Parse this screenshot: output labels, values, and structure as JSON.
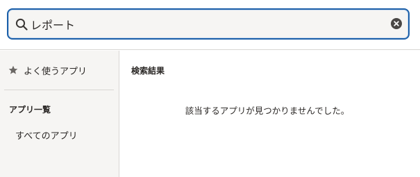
{
  "search": {
    "value": "レポート",
    "icon": "search-icon",
    "clear_icon": "close-circle-icon"
  },
  "sidebar": {
    "favorites": {
      "label": "よく使うアプリ",
      "icon": "star-icon"
    },
    "section_title": "アプリ一覧",
    "all_apps_label": "すべてのアプリ"
  },
  "main": {
    "results_title": "検索結果",
    "empty_message": "該当するアプリが見つかりませんでした。"
  },
  "colors": {
    "accent": "#1b5fa8",
    "sidebar_bg": "#f6f5f3",
    "text": "#2b2826"
  }
}
